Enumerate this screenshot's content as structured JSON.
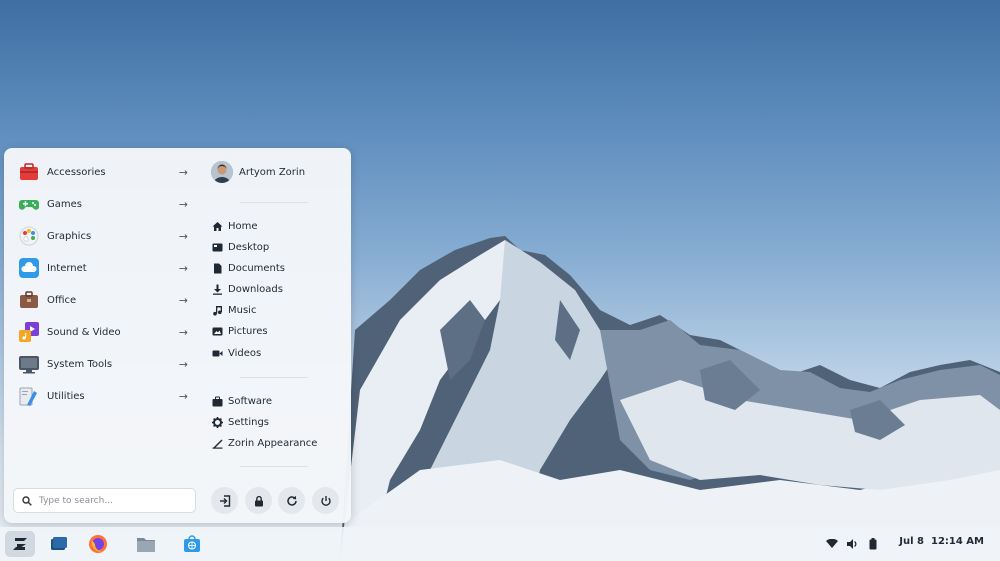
{
  "menu": {
    "categories": [
      {
        "label": "Accessories",
        "icon": "toolbox-icon"
      },
      {
        "label": "Games",
        "icon": "gamepad-icon"
      },
      {
        "label": "Graphics",
        "icon": "palette-icon"
      },
      {
        "label": "Internet",
        "icon": "cloud-icon"
      },
      {
        "label": "Office",
        "icon": "briefcase-icon"
      },
      {
        "label": "Sound & Video",
        "icon": "media-icon"
      },
      {
        "label": "System Tools",
        "icon": "monitor-icon"
      },
      {
        "label": "Utilities",
        "icon": "utilities-icon"
      }
    ],
    "user": {
      "name": "Artyom Zorin"
    },
    "places": [
      {
        "label": "Home",
        "icon": "home-icon"
      },
      {
        "label": "Desktop",
        "icon": "desktop-icon"
      },
      {
        "label": "Documents",
        "icon": "document-icon"
      },
      {
        "label": "Downloads",
        "icon": "download-icon"
      },
      {
        "label": "Music",
        "icon": "music-icon"
      },
      {
        "label": "Pictures",
        "icon": "picture-icon"
      },
      {
        "label": "Videos",
        "icon": "video-icon"
      }
    ],
    "system": [
      {
        "label": "Software",
        "icon": "software-icon"
      },
      {
        "label": "Settings",
        "icon": "settings-icon"
      },
      {
        "label": "Zorin Appearance",
        "icon": "appearance-icon"
      }
    ],
    "search": {
      "placeholder": "Type to search..."
    },
    "power_buttons": [
      "logout-icon",
      "lock-icon",
      "restart-icon",
      "power-icon"
    ]
  },
  "taskbar": {
    "apps": [
      "zorin-menu-icon",
      "workspaces-icon",
      "firefox-icon",
      "files-icon",
      "software-store-icon"
    ],
    "tray": [
      "wifi-icon",
      "volume-icon",
      "battery-icon"
    ],
    "clock": {
      "date": "Jul 8",
      "time": "12:14 AM"
    }
  }
}
